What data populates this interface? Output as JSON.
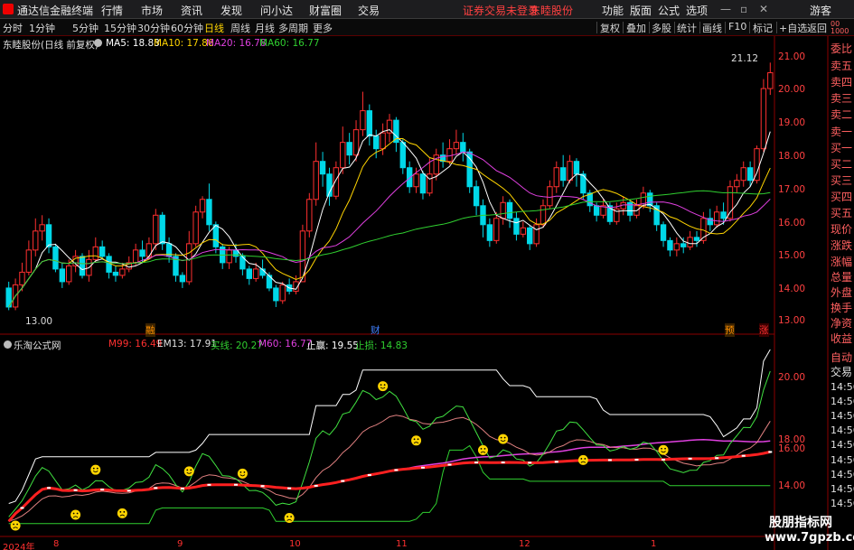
{
  "app": {
    "name": "通达信金融终端",
    "menu": [
      "行情",
      "市场",
      "资讯",
      "发现",
      "问小达",
      "财富圈",
      "交易"
    ],
    "notice": "证券交易未登录",
    "stock_title": "东睦股份",
    "right_menu": [
      "功能",
      "版面",
      "公式",
      "选项"
    ],
    "guest": "游客"
  },
  "toolbar": {
    "periods": [
      "分时",
      "1分钟",
      "5分钟",
      "15分钟",
      "30分钟",
      "60分钟",
      "日线",
      "周线",
      "月线",
      "多周期",
      "更多"
    ],
    "selected": "日线",
    "right": [
      "复权",
      "叠加",
      "多股",
      "统计",
      "画线",
      "F10",
      "标记",
      "+自选",
      "返回"
    ]
  },
  "main_chart": {
    "header": "东睦股份(日线 前复权)",
    "ma": [
      {
        "label": "MA5: 18.83",
        "color": "#ffffff"
      },
      {
        "label": "MA10: 17.86",
        "color": "#ffd400"
      },
      {
        "label": "MA20: 16.78",
        "color": "#e040e0"
      },
      {
        "label": "MA60: 16.77",
        "color": "#30d030"
      }
    ],
    "y_ticks": [
      "21.00",
      "20.00",
      "19.00",
      "18.00",
      "17.00",
      "16.00",
      "15.00",
      "14.00",
      "13.00"
    ],
    "high_label": "21.12",
    "low_label": "13.00",
    "markers": [
      {
        "text": "融",
        "color": "#ff9000"
      },
      {
        "text": "财",
        "color": "#4080ff"
      },
      {
        "text": "预",
        "color": "#ff9000"
      },
      {
        "text": "涨",
        "color": "#ff3030"
      }
    ]
  },
  "sub_chart": {
    "header": "乐淘公式网",
    "indicators": [
      {
        "label": "M99: 16.49",
        "color": "#ff3030"
      },
      {
        "label": "EM13: 17.91",
        "color": "#e0e0e0"
      },
      {
        "label": "买线: 20.27",
        "color": "#30d030"
      },
      {
        "label": "M60: 16.77",
        "color": "#e040e0"
      },
      {
        "label": "止赢: 19.55",
        "color": "#ffffff"
      },
      {
        "label": "止损: 14.83",
        "color": "#30d030"
      }
    ],
    "y_ticks": [
      "20.00",
      "18.00",
      "16.00",
      "14.00"
    ]
  },
  "x_axis": [
    "2024年",
    "8",
    "9",
    "10",
    "11",
    "12",
    "1"
  ],
  "side_panel": {
    "labels": [
      "委比",
      "卖五",
      "卖四",
      "卖三",
      "卖二",
      "卖一",
      "买一",
      "买二",
      "买三",
      "买四",
      "买五",
      "现价",
      "涨跌",
      "涨幅",
      "总量",
      "外盘",
      "换手",
      "净资",
      "收益"
    ],
    "auto_label": "自动",
    "trade_label": "交易",
    "times": [
      "14:56",
      "14:56",
      "14:56",
      "14:56",
      "14:56",
      "14:56",
      "14:56",
      "14:56",
      "14:56"
    ]
  },
  "watermark": {
    "line1": "股朋指标网",
    "line2": "www.7gpzb.com"
  },
  "chart_data": {
    "type": "candlestick",
    "title": "东睦股份(日线 前复权)",
    "ylim": [
      12.6,
      21.5
    ],
    "x_labels": [
      "2024年",
      "8",
      "9",
      "10",
      "11",
      "12",
      "1"
    ],
    "candles": [
      [
        14.0,
        13.4,
        14.2,
        13.3
      ],
      [
        13.4,
        14.1,
        14.3,
        13.3
      ],
      [
        14.1,
        14.5,
        14.8,
        13.9
      ],
      [
        14.5,
        15.2,
        15.5,
        14.4
      ],
      [
        15.2,
        15.8,
        16.2,
        15.0
      ],
      [
        15.8,
        16.0,
        16.3,
        15.5
      ],
      [
        16.0,
        15.3,
        16.2,
        15.1
      ],
      [
        15.3,
        14.6,
        15.4,
        14.5
      ],
      [
        14.6,
        14.2,
        14.8,
        14.0
      ],
      [
        14.2,
        14.7,
        14.9,
        14.1
      ],
      [
        14.7,
        15.0,
        15.2,
        14.5
      ],
      [
        15.0,
        14.4,
        15.1,
        14.3
      ],
      [
        14.4,
        14.9,
        15.2,
        14.2
      ],
      [
        14.9,
        15.3,
        15.6,
        14.8
      ],
      [
        15.3,
        15.0,
        15.5,
        14.9
      ],
      [
        15.0,
        14.5,
        15.1,
        14.3
      ],
      [
        14.5,
        14.4,
        14.7,
        14.2
      ],
      [
        14.4,
        14.6,
        14.8,
        14.3
      ],
      [
        14.6,
        14.8,
        15.0,
        14.5
      ],
      [
        14.8,
        15.2,
        15.4,
        14.7
      ],
      [
        15.2,
        15.0,
        15.5,
        14.8
      ],
      [
        15.0,
        15.4,
        15.6,
        14.9
      ],
      [
        15.4,
        16.3,
        16.5,
        15.2
      ],
      [
        16.3,
        15.4,
        16.4,
        15.2
      ],
      [
        15.4,
        15.0,
        15.6,
        14.8
      ],
      [
        15.0,
        14.4,
        15.1,
        14.2
      ],
      [
        14.4,
        14.2,
        14.5,
        14.0
      ],
      [
        14.2,
        15.4,
        15.8,
        14.1
      ],
      [
        15.4,
        16.4,
        16.6,
        15.3
      ],
      [
        16.4,
        16.8,
        16.9,
        16.2
      ],
      [
        16.8,
        16.0,
        17.3,
        15.8
      ],
      [
        16.0,
        15.3,
        16.1,
        15.1
      ],
      [
        15.3,
        14.8,
        15.4,
        14.6
      ],
      [
        14.8,
        15.2,
        15.3,
        14.6
      ],
      [
        15.2,
        15.0,
        15.4,
        14.8
      ],
      [
        15.0,
        14.6,
        15.1,
        14.4
      ],
      [
        14.6,
        14.3,
        14.7,
        14.1
      ],
      [
        14.3,
        14.6,
        14.8,
        14.2
      ],
      [
        14.6,
        14.4,
        14.9,
        14.3
      ],
      [
        14.4,
        14.0,
        14.5,
        13.9
      ],
      [
        14.0,
        13.6,
        14.1,
        13.4
      ],
      [
        13.6,
        14.1,
        14.2,
        13.5
      ],
      [
        14.1,
        13.9,
        14.3,
        13.8
      ],
      [
        13.9,
        14.2,
        14.4,
        13.8
      ],
      [
        14.2,
        15.8,
        16.0,
        14.2
      ],
      [
        15.8,
        16.8,
        17.0,
        15.6
      ],
      [
        16.8,
        18.0,
        18.6,
        16.6
      ],
      [
        18.0,
        17.6,
        18.3,
        17.2
      ],
      [
        17.6,
        16.9,
        17.8,
        16.6
      ],
      [
        16.9,
        17.8,
        18.0,
        16.8
      ],
      [
        17.8,
        18.6,
        19.1,
        17.6
      ],
      [
        18.6,
        18.2,
        18.9,
        17.9
      ],
      [
        18.2,
        19.0,
        19.3,
        18.0
      ],
      [
        19.0,
        19.6,
        20.2,
        18.8
      ],
      [
        19.6,
        18.8,
        19.8,
        18.5
      ],
      [
        18.8,
        18.4,
        19.0,
        18.1
      ],
      [
        18.4,
        18.9,
        19.2,
        18.2
      ],
      [
        18.9,
        19.3,
        19.5,
        18.6
      ],
      [
        19.3,
        18.6,
        19.4,
        18.3
      ],
      [
        18.6,
        17.8,
        18.7,
        17.6
      ],
      [
        17.8,
        17.2,
        18.0,
        17.0
      ],
      [
        17.2,
        17.6,
        17.8,
        17.0
      ],
      [
        17.6,
        17.0,
        17.7,
        16.8
      ],
      [
        17.0,
        17.6,
        18.1,
        16.9
      ],
      [
        17.6,
        18.2,
        18.4,
        17.4
      ],
      [
        18.2,
        18.0,
        18.6,
        17.8
      ],
      [
        18.0,
        18.4,
        18.7,
        17.9
      ],
      [
        18.4,
        18.6,
        19.0,
        18.2
      ],
      [
        18.6,
        18.3,
        18.9,
        18.0
      ],
      [
        18.3,
        17.2,
        18.4,
        17.0
      ],
      [
        17.2,
        16.6,
        17.4,
        16.3
      ],
      [
        16.6,
        16.0,
        16.8,
        15.6
      ],
      [
        16.0,
        15.5,
        16.2,
        15.3
      ],
      [
        15.5,
        16.2,
        16.4,
        15.4
      ],
      [
        16.2,
        16.7,
        16.9,
        16.0
      ],
      [
        16.7,
        16.2,
        16.8,
        15.9
      ],
      [
        16.2,
        15.7,
        16.4,
        15.5
      ],
      [
        15.7,
        15.9,
        16.1,
        15.6
      ],
      [
        15.9,
        15.4,
        16.0,
        15.2
      ],
      [
        15.4,
        16.0,
        16.2,
        15.3
      ],
      [
        16.0,
        16.6,
        16.8,
        15.9
      ],
      [
        16.6,
        17.2,
        17.4,
        16.5
      ],
      [
        17.2,
        17.8,
        18.0,
        17.0
      ],
      [
        17.8,
        17.4,
        18.2,
        17.2
      ],
      [
        17.4,
        18.0,
        18.2,
        17.3
      ],
      [
        18.0,
        17.6,
        18.1,
        17.2
      ],
      [
        17.6,
        17.0,
        17.7,
        16.8
      ],
      [
        17.0,
        16.6,
        17.1,
        16.4
      ],
      [
        16.6,
        16.3,
        16.7,
        16.1
      ],
      [
        16.3,
        16.6,
        16.8,
        16.2
      ],
      [
        16.6,
        16.1,
        16.7,
        16.0
      ],
      [
        16.1,
        16.5,
        16.7,
        16.0
      ],
      [
        16.5,
        16.7,
        16.9,
        16.3
      ],
      [
        16.7,
        16.3,
        16.8,
        16.1
      ],
      [
        16.3,
        16.6,
        16.8,
        16.2
      ],
      [
        16.6,
        17.0,
        17.2,
        16.5
      ],
      [
        17.0,
        16.6,
        17.1,
        16.4
      ],
      [
        16.6,
        16.0,
        16.7,
        15.8
      ],
      [
        16.0,
        15.5,
        16.1,
        15.3
      ],
      [
        15.5,
        15.2,
        15.6,
        15.0
      ],
      [
        15.2,
        15.4,
        15.6,
        15.0
      ],
      [
        15.4,
        15.3,
        15.6,
        15.1
      ],
      [
        15.3,
        15.6,
        15.8,
        15.2
      ],
      [
        15.6,
        15.5,
        15.8,
        15.3
      ],
      [
        15.5,
        16.2,
        16.4,
        15.4
      ],
      [
        16.2,
        16.0,
        16.5,
        15.8
      ],
      [
        16.0,
        16.4,
        16.6,
        15.9
      ],
      [
        16.4,
        16.2,
        16.7,
        16.0
      ],
      [
        16.2,
        17.2,
        17.4,
        16.1
      ],
      [
        17.2,
        17.4,
        17.6,
        17.0
      ],
      [
        17.4,
        17.8,
        18.0,
        17.2
      ],
      [
        17.8,
        17.4,
        18.0,
        17.2
      ],
      [
        17.4,
        18.4,
        18.5,
        17.3
      ],
      [
        18.4,
        20.3,
        20.6,
        18.3
      ],
      [
        20.3,
        20.8,
        21.12,
        20.1
      ]
    ],
    "ma_lines": [
      {
        "name": "MA5",
        "last": 18.83,
        "color": "#ffffff"
      },
      {
        "name": "MA10",
        "last": 17.86,
        "color": "#ffd400"
      },
      {
        "name": "MA20",
        "last": 16.78,
        "color": "#e040e0"
      },
      {
        "name": "MA60",
        "last": 16.77,
        "color": "#30d030"
      }
    ],
    "sub_lines": [
      {
        "name": "M99",
        "last": 16.49,
        "color": "#ff3030"
      },
      {
        "name": "EM13",
        "last": 17.91,
        "color": "#e0e0e0"
      },
      {
        "name": "买线",
        "last": 20.27,
        "color": "#30d030"
      },
      {
        "name": "M60",
        "last": 16.77,
        "color": "#e040e0"
      },
      {
        "name": "止赢",
        "last": 19.55,
        "color": "#ffffff"
      },
      {
        "name": "止损",
        "last": 14.83,
        "color": "#30d030"
      }
    ],
    "sub_ylim": [
      12.8,
      21.0
    ],
    "buy_signals": [
      13,
      27,
      35,
      56,
      74,
      98
    ],
    "sell_signals": [
      1,
      10,
      17,
      42,
      61,
      71,
      86
    ]
  }
}
